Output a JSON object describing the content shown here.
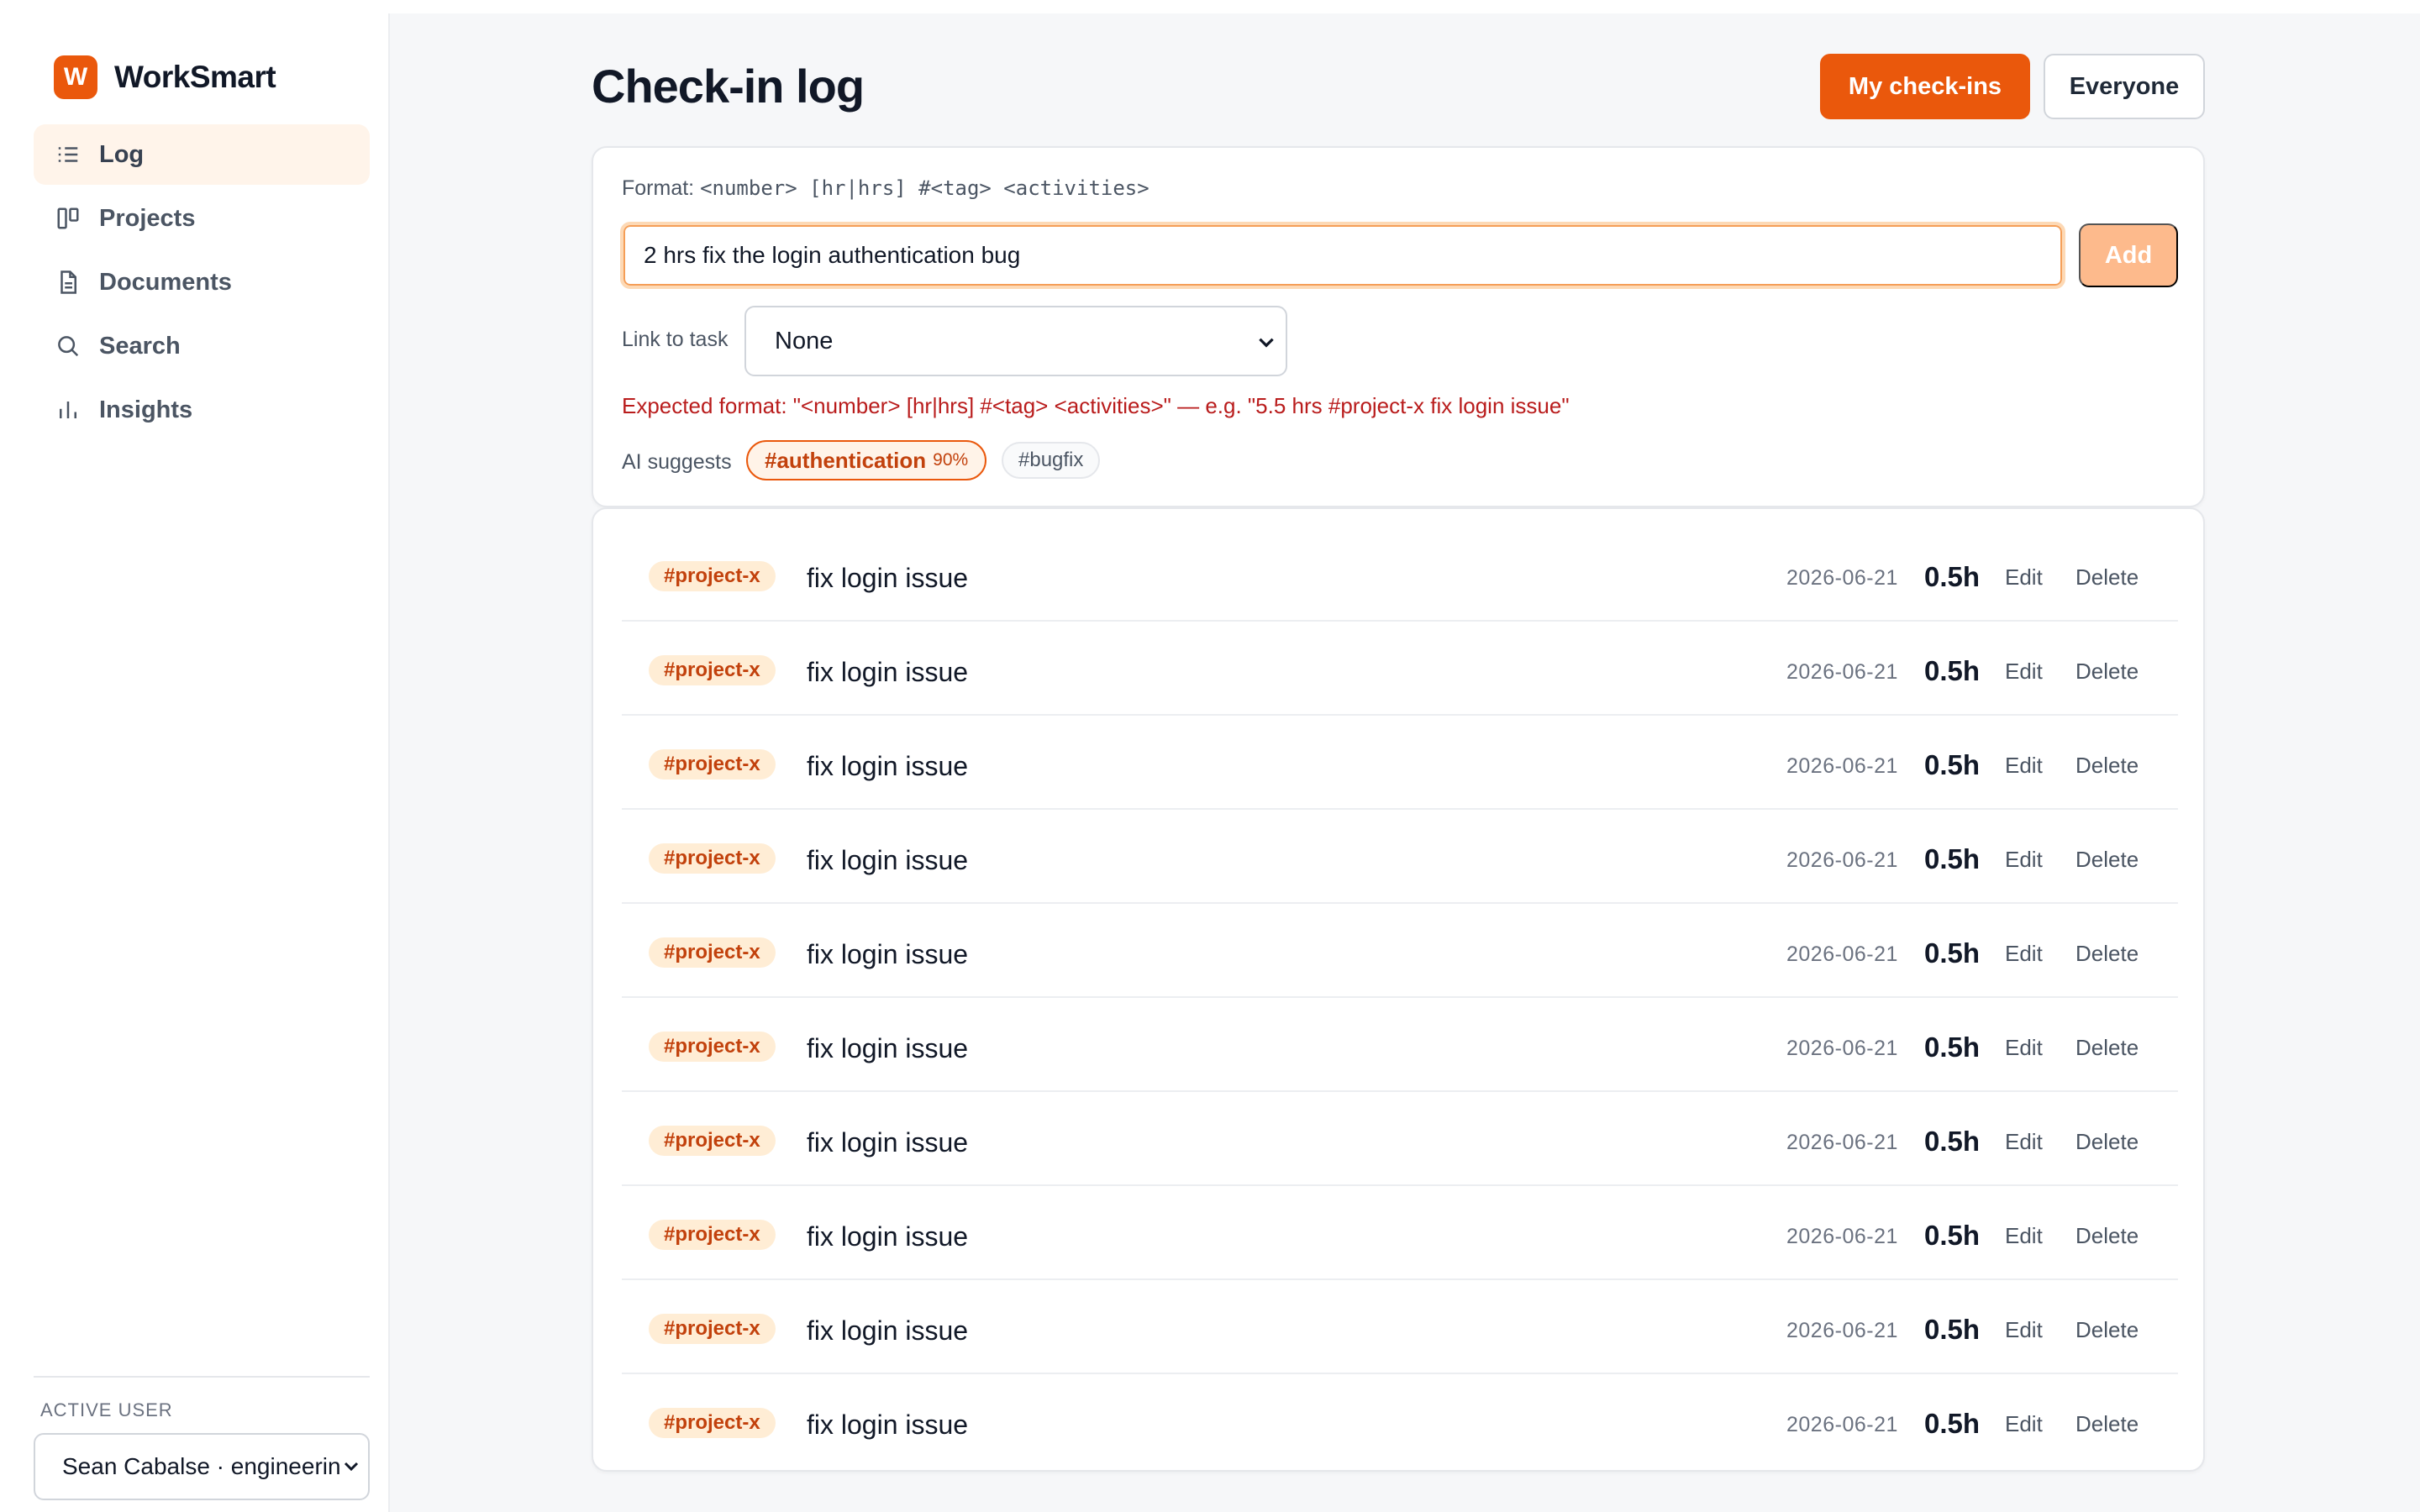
{
  "brand": {
    "logo_letter": "W",
    "name": "WorkSmart",
    "accent": "#ea580c"
  },
  "sidebar": {
    "items": [
      {
        "label": "Log",
        "icon": "list-icon",
        "active": true
      },
      {
        "label": "Projects",
        "icon": "kanban-icon"
      },
      {
        "label": "Documents",
        "icon": "document-icon"
      },
      {
        "label": "Search",
        "icon": "search-icon"
      },
      {
        "label": "Insights",
        "icon": "bar-chart-icon"
      }
    ],
    "active_user_label": "ACTIVE USER",
    "active_user_value": "Sean Cabalse · engineering"
  },
  "header": {
    "title": "Check-in log",
    "my_checkins": "My check-ins",
    "everyone": "Everyone"
  },
  "entry": {
    "format_label": "Format:",
    "format_syntax": "<number> [hr|hrs] #<tag> <activities>",
    "input_value": "2 hrs fix the login authentication bug",
    "add_label": "Add",
    "link_label": "Link to task",
    "task_selected": "None",
    "error": "Expected format: \"<number> [hr|hrs] #<tag> <activities>\" — e.g. \"5.5 hrs #project-x fix login issue\"",
    "ai_label": "AI suggests",
    "suggestions": [
      {
        "tag": "#authentication",
        "confidence": "90%"
      },
      {
        "tag": "#bugfix"
      }
    ]
  },
  "entries": [
    {
      "tag": "#project-x",
      "activity": "fix login issue",
      "date": "2026-06-21",
      "hours": "0.5h",
      "edit": "Edit",
      "delete": "Delete"
    },
    {
      "tag": "#project-x",
      "activity": "fix login issue",
      "date": "2026-06-21",
      "hours": "0.5h",
      "edit": "Edit",
      "delete": "Delete"
    },
    {
      "tag": "#project-x",
      "activity": "fix login issue",
      "date": "2026-06-21",
      "hours": "0.5h",
      "edit": "Edit",
      "delete": "Delete"
    },
    {
      "tag": "#project-x",
      "activity": "fix login issue",
      "date": "2026-06-21",
      "hours": "0.5h",
      "edit": "Edit",
      "delete": "Delete"
    },
    {
      "tag": "#project-x",
      "activity": "fix login issue",
      "date": "2026-06-21",
      "hours": "0.5h",
      "edit": "Edit",
      "delete": "Delete"
    },
    {
      "tag": "#project-x",
      "activity": "fix login issue",
      "date": "2026-06-21",
      "hours": "0.5h",
      "edit": "Edit",
      "delete": "Delete"
    },
    {
      "tag": "#project-x",
      "activity": "fix login issue",
      "date": "2026-06-21",
      "hours": "0.5h",
      "edit": "Edit",
      "delete": "Delete"
    },
    {
      "tag": "#project-x",
      "activity": "fix login issue",
      "date": "2026-06-21",
      "hours": "0.5h",
      "edit": "Edit",
      "delete": "Delete"
    },
    {
      "tag": "#project-x",
      "activity": "fix login issue",
      "date": "2026-06-21",
      "hours": "0.5h",
      "edit": "Edit",
      "delete": "Delete"
    },
    {
      "tag": "#project-x",
      "activity": "fix login issue",
      "date": "2026-06-21",
      "hours": "0.5h",
      "edit": "Edit",
      "delete": "Delete"
    }
  ]
}
